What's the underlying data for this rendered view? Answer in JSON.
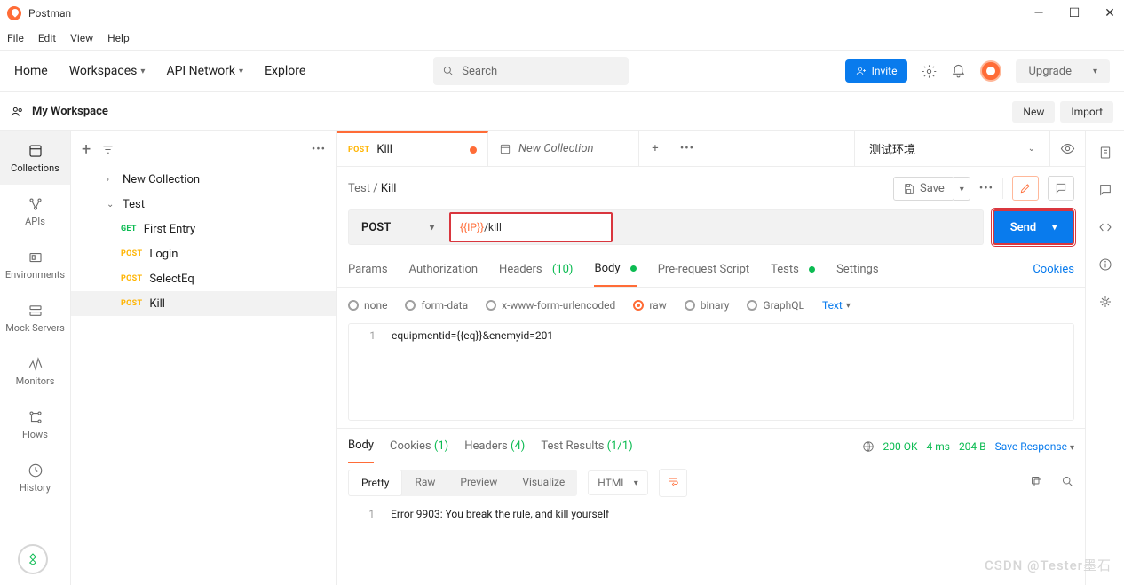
{
  "app": {
    "title": "Postman"
  },
  "menu": {
    "file": "File",
    "edit": "Edit",
    "view": "View",
    "help": "Help"
  },
  "topnav": {
    "home": "Home",
    "workspaces": "Workspaces",
    "api_network": "API Network",
    "explore": "Explore"
  },
  "search": {
    "placeholder": "Search"
  },
  "invite": {
    "label": "Invite"
  },
  "upgrade": {
    "label": "Upgrade"
  },
  "workspace": {
    "name": "My Workspace",
    "new": "New",
    "import": "Import"
  },
  "rail": {
    "collections": "Collections",
    "apis": "APIs",
    "environments": "Environments",
    "mock_servers": "Mock Servers",
    "monitors": "Monitors",
    "flows": "Flows",
    "history": "History"
  },
  "tree": {
    "new_collection": "New Collection",
    "test": "Test",
    "items": [
      {
        "method": "GET",
        "name": "First Entry"
      },
      {
        "method": "POST",
        "name": "Login"
      },
      {
        "method": "POST",
        "name": "SelectEq"
      },
      {
        "method": "POST",
        "name": "Kill"
      }
    ]
  },
  "tabs": {
    "active": {
      "method": "POST",
      "name": "Kill"
    },
    "other": {
      "name": "New Collection"
    }
  },
  "env": {
    "selected": "测试环境"
  },
  "breadcrumb": {
    "parent": "Test",
    "current": "Kill",
    "save": "Save"
  },
  "request": {
    "method": "POST",
    "url_var": "{{IP}}",
    "url_rest": "/kill",
    "send": "Send"
  },
  "req_tabs": {
    "params": "Params",
    "auth": "Authorization",
    "headers": "Headers",
    "headers_count": "(10)",
    "body": "Body",
    "prerequest": "Pre-request Script",
    "tests": "Tests",
    "settings": "Settings",
    "cookies": "Cookies"
  },
  "body_type": {
    "none": "none",
    "formdata": "form-data",
    "xwww": "x-www-form-urlencoded",
    "raw": "raw",
    "binary": "binary",
    "graphql": "GraphQL",
    "text": "Text"
  },
  "editor": {
    "line1": "1",
    "body": "equipmentid={{eq}}&enemyid=201"
  },
  "resp_tabs": {
    "body": "Body",
    "cookies": "Cookies",
    "cookies_count": "(1)",
    "headers": "Headers",
    "headers_count": "(4)",
    "tests": "Test Results",
    "tests_count": "(1/1)"
  },
  "resp_status": {
    "status": "200 OK",
    "time": "4 ms",
    "size": "204 B",
    "save": "Save Response"
  },
  "resp_view": {
    "pretty": "Pretty",
    "raw": "Raw",
    "preview": "Preview",
    "visualize": "Visualize",
    "format": "HTML"
  },
  "resp_body": {
    "line1": "1",
    "content": "Error 9903: You break the rule, and kill yourself"
  },
  "watermark": "CSDN @Tester墨石"
}
